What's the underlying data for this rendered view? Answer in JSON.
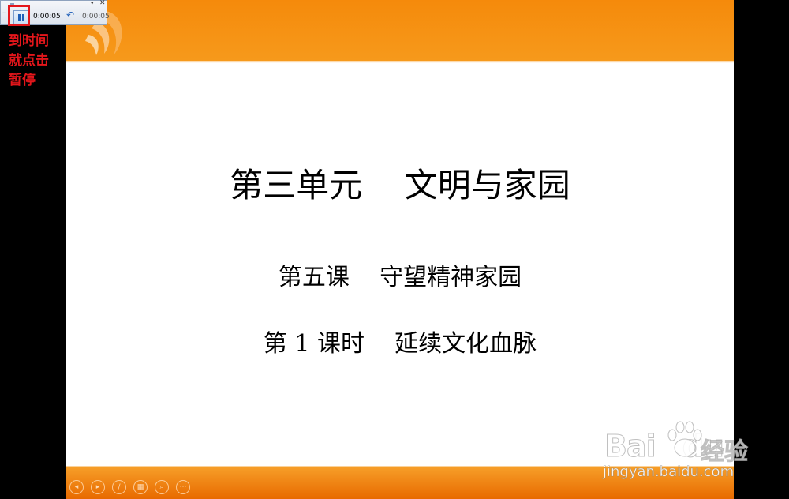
{
  "recorder": {
    "elapsed_time": "0:00:05",
    "total_time": "0:00:05",
    "minimize_glyph": "–",
    "dropdown_glyph": "▾",
    "close_glyph": "✕",
    "undo_glyph": "↶"
  },
  "annotation": {
    "text": "到时间\n就点击\n暂停",
    "color": "#e4161b"
  },
  "slide": {
    "title": "第三单元    文明与家园",
    "subtitle_lesson": "第五课    守望精神家园",
    "subtitle_period": "第 1 课时    延续文化血脉",
    "accent_color": "#f58a0b"
  },
  "nav_controls": [
    {
      "icon": "previous-icon",
      "glyph": "◂"
    },
    {
      "icon": "next-icon",
      "glyph": "▸"
    },
    {
      "icon": "pen-icon",
      "glyph": "∕"
    },
    {
      "icon": "slides-grid-icon",
      "glyph": "▦"
    },
    {
      "icon": "zoom-icon",
      "glyph": "⌕"
    },
    {
      "icon": "more-options-icon",
      "glyph": "⋯"
    }
  ],
  "watermark": {
    "logo_text": "Bai",
    "logo_text_2": "du",
    "brand": "经验",
    "url": "jingyan.baidu.com"
  }
}
